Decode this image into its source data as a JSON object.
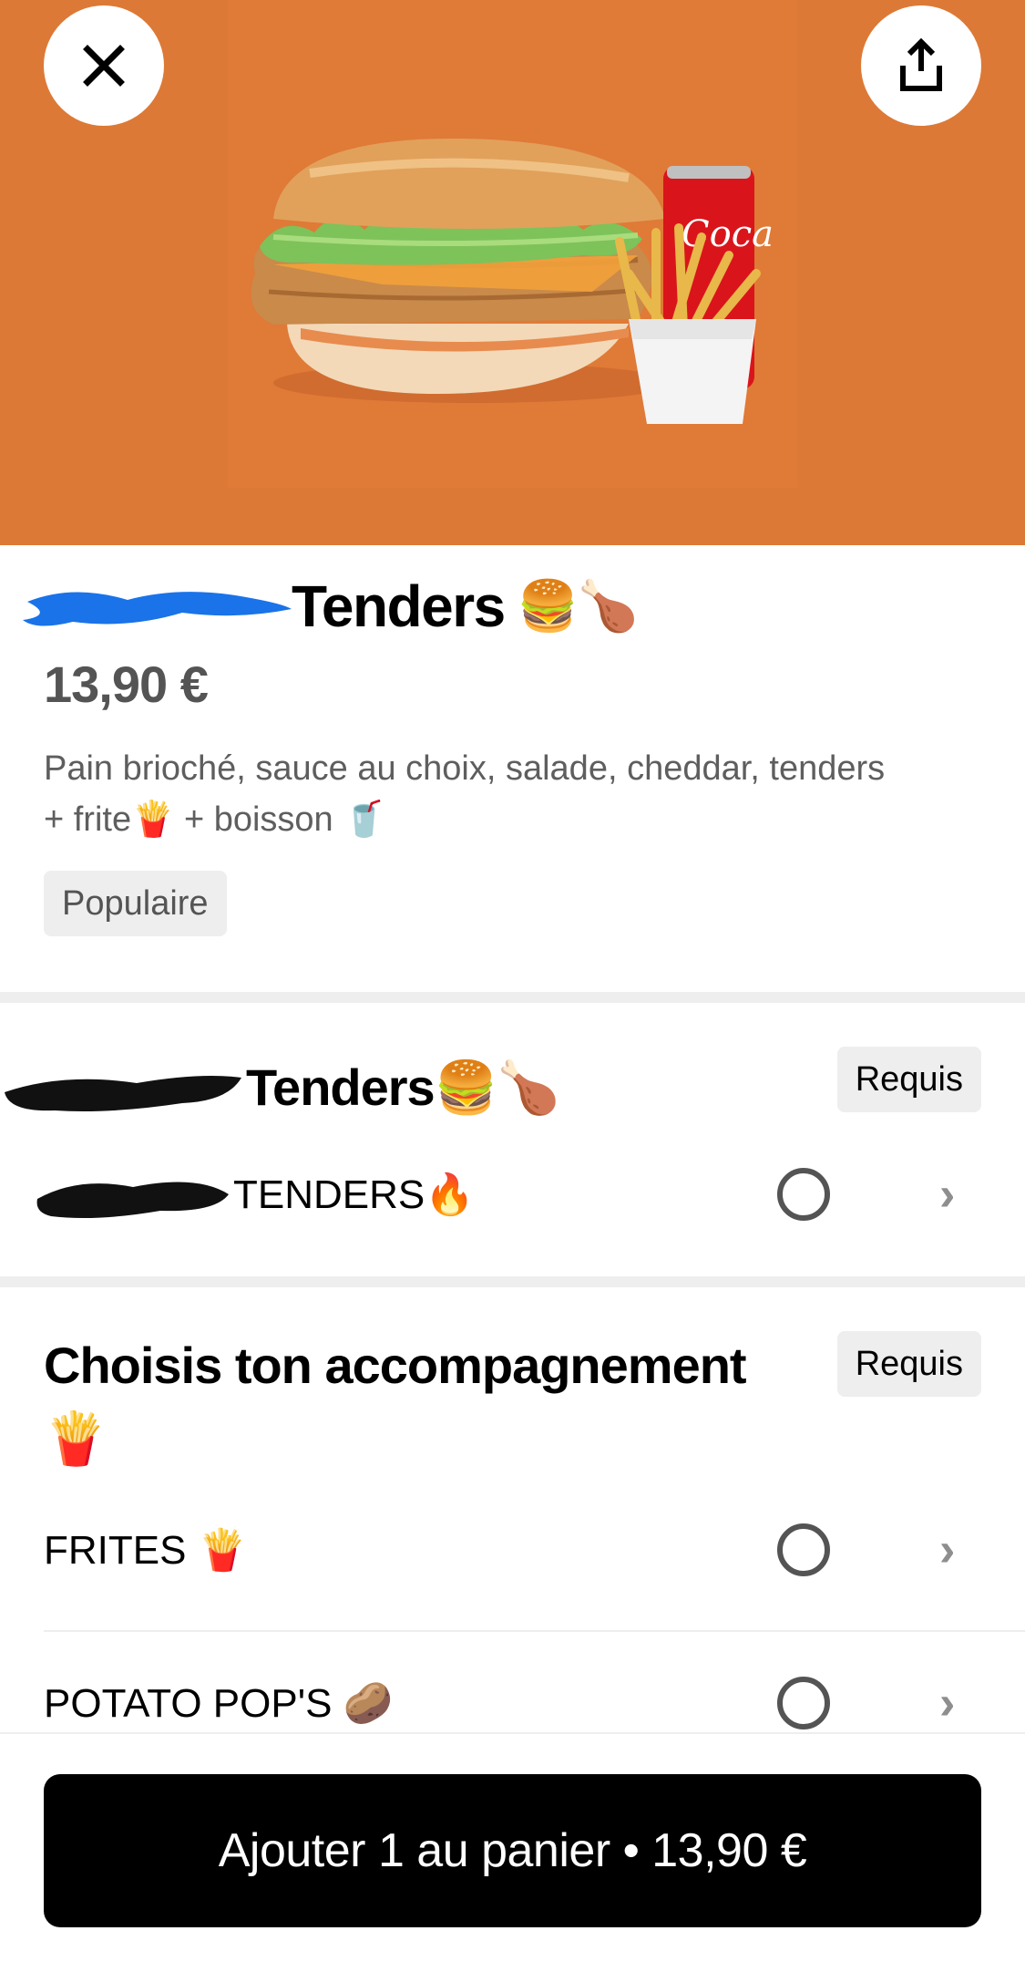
{
  "hero": {
    "image_alt": "Burger poulet pané, frites et canette Coca-Cola"
  },
  "header": {
    "close_icon": "close-icon",
    "share_icon": "share-icon"
  },
  "product": {
    "name_suffix": "Tenders",
    "name_emoji": "🍔🍗",
    "price": "13,90 €",
    "description_line1": "Pain brioché, sauce au choix, salade, cheddar, tenders",
    "description_line2": "+ frite🍟 + boisson 🥤",
    "tag": "Populaire"
  },
  "sections": [
    {
      "title": "Tenders🍔🍗",
      "badge": "Requis",
      "options": [
        {
          "label": "TENDERS🔥"
        }
      ]
    },
    {
      "title": "Choisis ton accompagnement",
      "title_emoji": "🍟",
      "badge": "Requis",
      "options": [
        {
          "label": "FRITES 🍟"
        },
        {
          "label": "POTATO POP'S 🥔"
        }
      ]
    }
  ],
  "cart_button": {
    "label": "Ajouter 1 au panier • 13,90 €"
  },
  "colors": {
    "hero_bg": "#dd7936",
    "cta_bg": "#000000",
    "badge_bg": "#eeeeee"
  }
}
